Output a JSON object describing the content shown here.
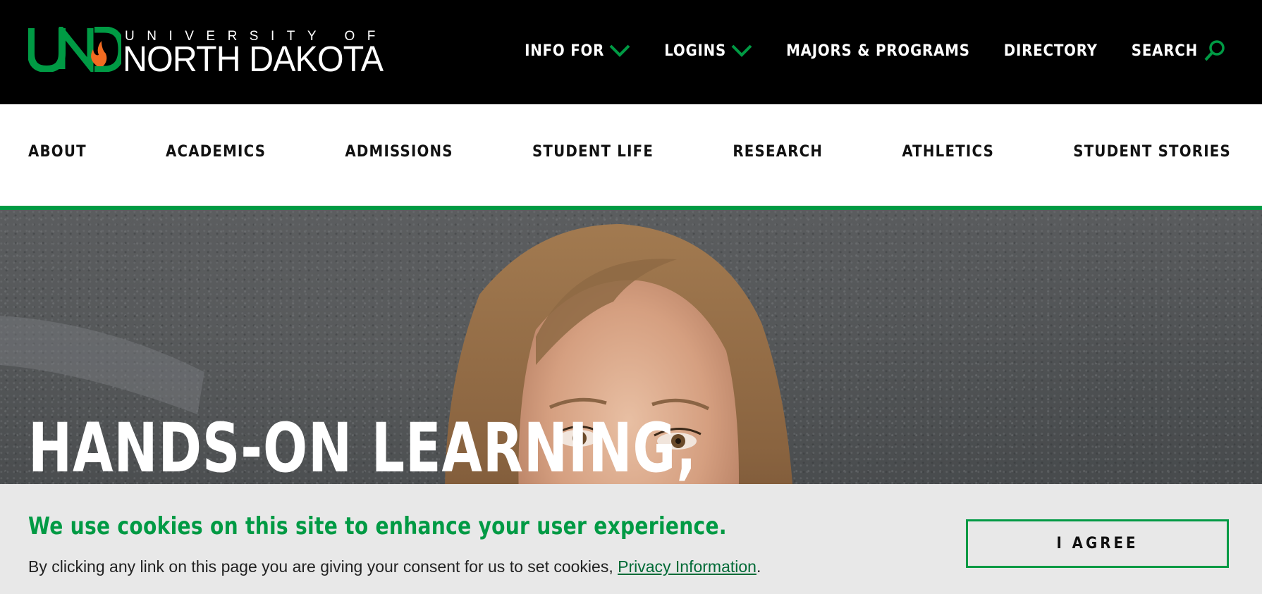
{
  "brand": {
    "monogram": "UND",
    "university_of": "UNIVERSITY OF",
    "name": "NORTH DAKOTA",
    "green": "#009a44",
    "flame": "#f26b21"
  },
  "utility_nav": {
    "info_for": "INFO FOR",
    "logins": "LOGINS",
    "majors": "MAJORS & PROGRAMS",
    "directory": "DIRECTORY",
    "search": "SEARCH"
  },
  "main_nav": {
    "items": [
      "ABOUT",
      "ACADEMICS",
      "ADMISSIONS",
      "STUDENT LIFE",
      "RESEARCH",
      "ATHLETICS",
      "STUDENT STORIES"
    ]
  },
  "hero": {
    "headline": "HANDS-ON LEARNING,"
  },
  "cookie_banner": {
    "title": "We use cookies on this site to enhance your user experience.",
    "text": "By clicking any link on this page you are giving your consent for us to set cookies, ",
    "link": "Privacy Information",
    "period": ".",
    "button": "I AGREE"
  }
}
